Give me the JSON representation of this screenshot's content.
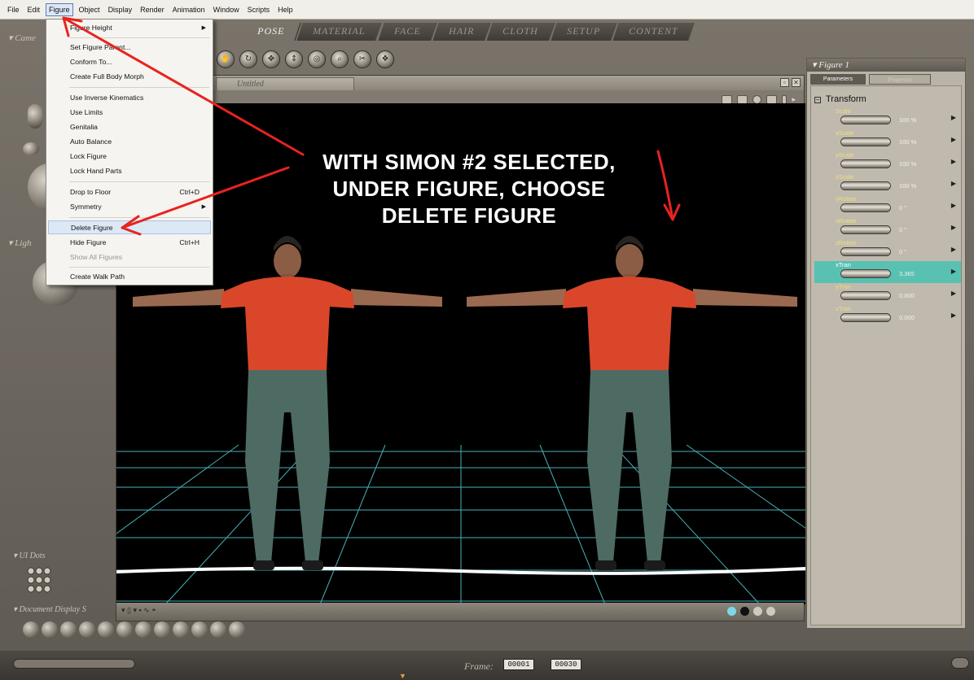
{
  "menubar": {
    "items": [
      "File",
      "Edit",
      "Figure",
      "Object",
      "Display",
      "Render",
      "Animation",
      "Window",
      "Scripts",
      "Help"
    ],
    "active": "Figure"
  },
  "tabs": [
    "POSE",
    "MATERIAL",
    "FACE",
    "HAIR",
    "CLOTH",
    "SETUP",
    "CONTENT"
  ],
  "active_tab": "POSE",
  "figure_menu": {
    "items": [
      {
        "label": "Figure Height",
        "shortcut": "",
        "submenu": true,
        "disabled": false
      },
      {
        "label": "Set Figure Parent...",
        "shortcut": "",
        "submenu": false,
        "disabled": false
      },
      {
        "label": "Conform To...",
        "shortcut": "",
        "submenu": false,
        "disabled": false
      },
      {
        "label": "Create Full Body Morph",
        "shortcut": "",
        "submenu": false,
        "disabled": false
      },
      {
        "label": "Use Inverse Kinematics",
        "shortcut": "",
        "submenu": false,
        "disabled": false
      },
      {
        "label": "Use Limits",
        "shortcut": "",
        "submenu": false,
        "disabled": false
      },
      {
        "label": "Genitalia",
        "shortcut": "",
        "submenu": false,
        "disabled": false
      },
      {
        "label": "Auto Balance",
        "shortcut": "",
        "submenu": false,
        "disabled": false
      },
      {
        "label": "Lock Figure",
        "shortcut": "",
        "submenu": false,
        "disabled": false
      },
      {
        "label": "Lock Hand Parts",
        "shortcut": "",
        "submenu": false,
        "disabled": false
      },
      {
        "label": "Drop to Floor",
        "shortcut": "Ctrl+D",
        "submenu": false,
        "disabled": false
      },
      {
        "label": "Symmetry",
        "shortcut": "",
        "submenu": true,
        "disabled": false
      },
      {
        "label": "Delete Figure",
        "shortcut": "",
        "submenu": false,
        "disabled": false,
        "highlighted": true
      },
      {
        "label": "Hide Figure",
        "shortcut": "Ctrl+H",
        "submenu": false,
        "disabled": false
      },
      {
        "label": "Show All Figures",
        "shortcut": "",
        "submenu": false,
        "disabled": true
      },
      {
        "label": "Create Walk Path",
        "shortcut": "",
        "submenu": false,
        "disabled": false
      }
    ]
  },
  "document": {
    "tab_label": "Untitled"
  },
  "overlay_text": [
    "WITH SIMON #2 SELECTED,",
    "UNDER FIGURE, CHOOSE",
    "DELETE FIGURE"
  ],
  "right_panel": {
    "title": "Figure 1",
    "tabs": [
      "Parameters",
      "Properties"
    ],
    "group": "Transform",
    "params": [
      {
        "label": "Scale",
        "value": "100 %"
      },
      {
        "label": "xScale",
        "value": "100 %"
      },
      {
        "label": "yScale",
        "value": "100 %"
      },
      {
        "label": "zScale",
        "value": "100 %"
      },
      {
        "label": "yRotate",
        "value": "0 °"
      },
      {
        "label": "xRotate",
        "value": "0 °"
      },
      {
        "label": "zRotate",
        "value": "0 °"
      },
      {
        "label": "xTran",
        "value": "3.365",
        "selected": true
      },
      {
        "label": "yTran",
        "value": "0.000"
      },
      {
        "label": "zTran",
        "value": "0.000"
      }
    ]
  },
  "left_panel": {
    "camera_label": "Came",
    "lights_label": "Ligh",
    "ui_dots_label": "UI Dots",
    "doc_display_label": "Document Display S"
  },
  "timeline": {
    "frame_label": "Frame:",
    "current_frame": "00001",
    "total_frames": "00030"
  },
  "colors": {
    "annotation_red": "#e8231f",
    "selected_param": "#58c1b2",
    "grid": "#5fd0d8",
    "shirt": "#d9462a",
    "jeans": "#4d6b63"
  }
}
